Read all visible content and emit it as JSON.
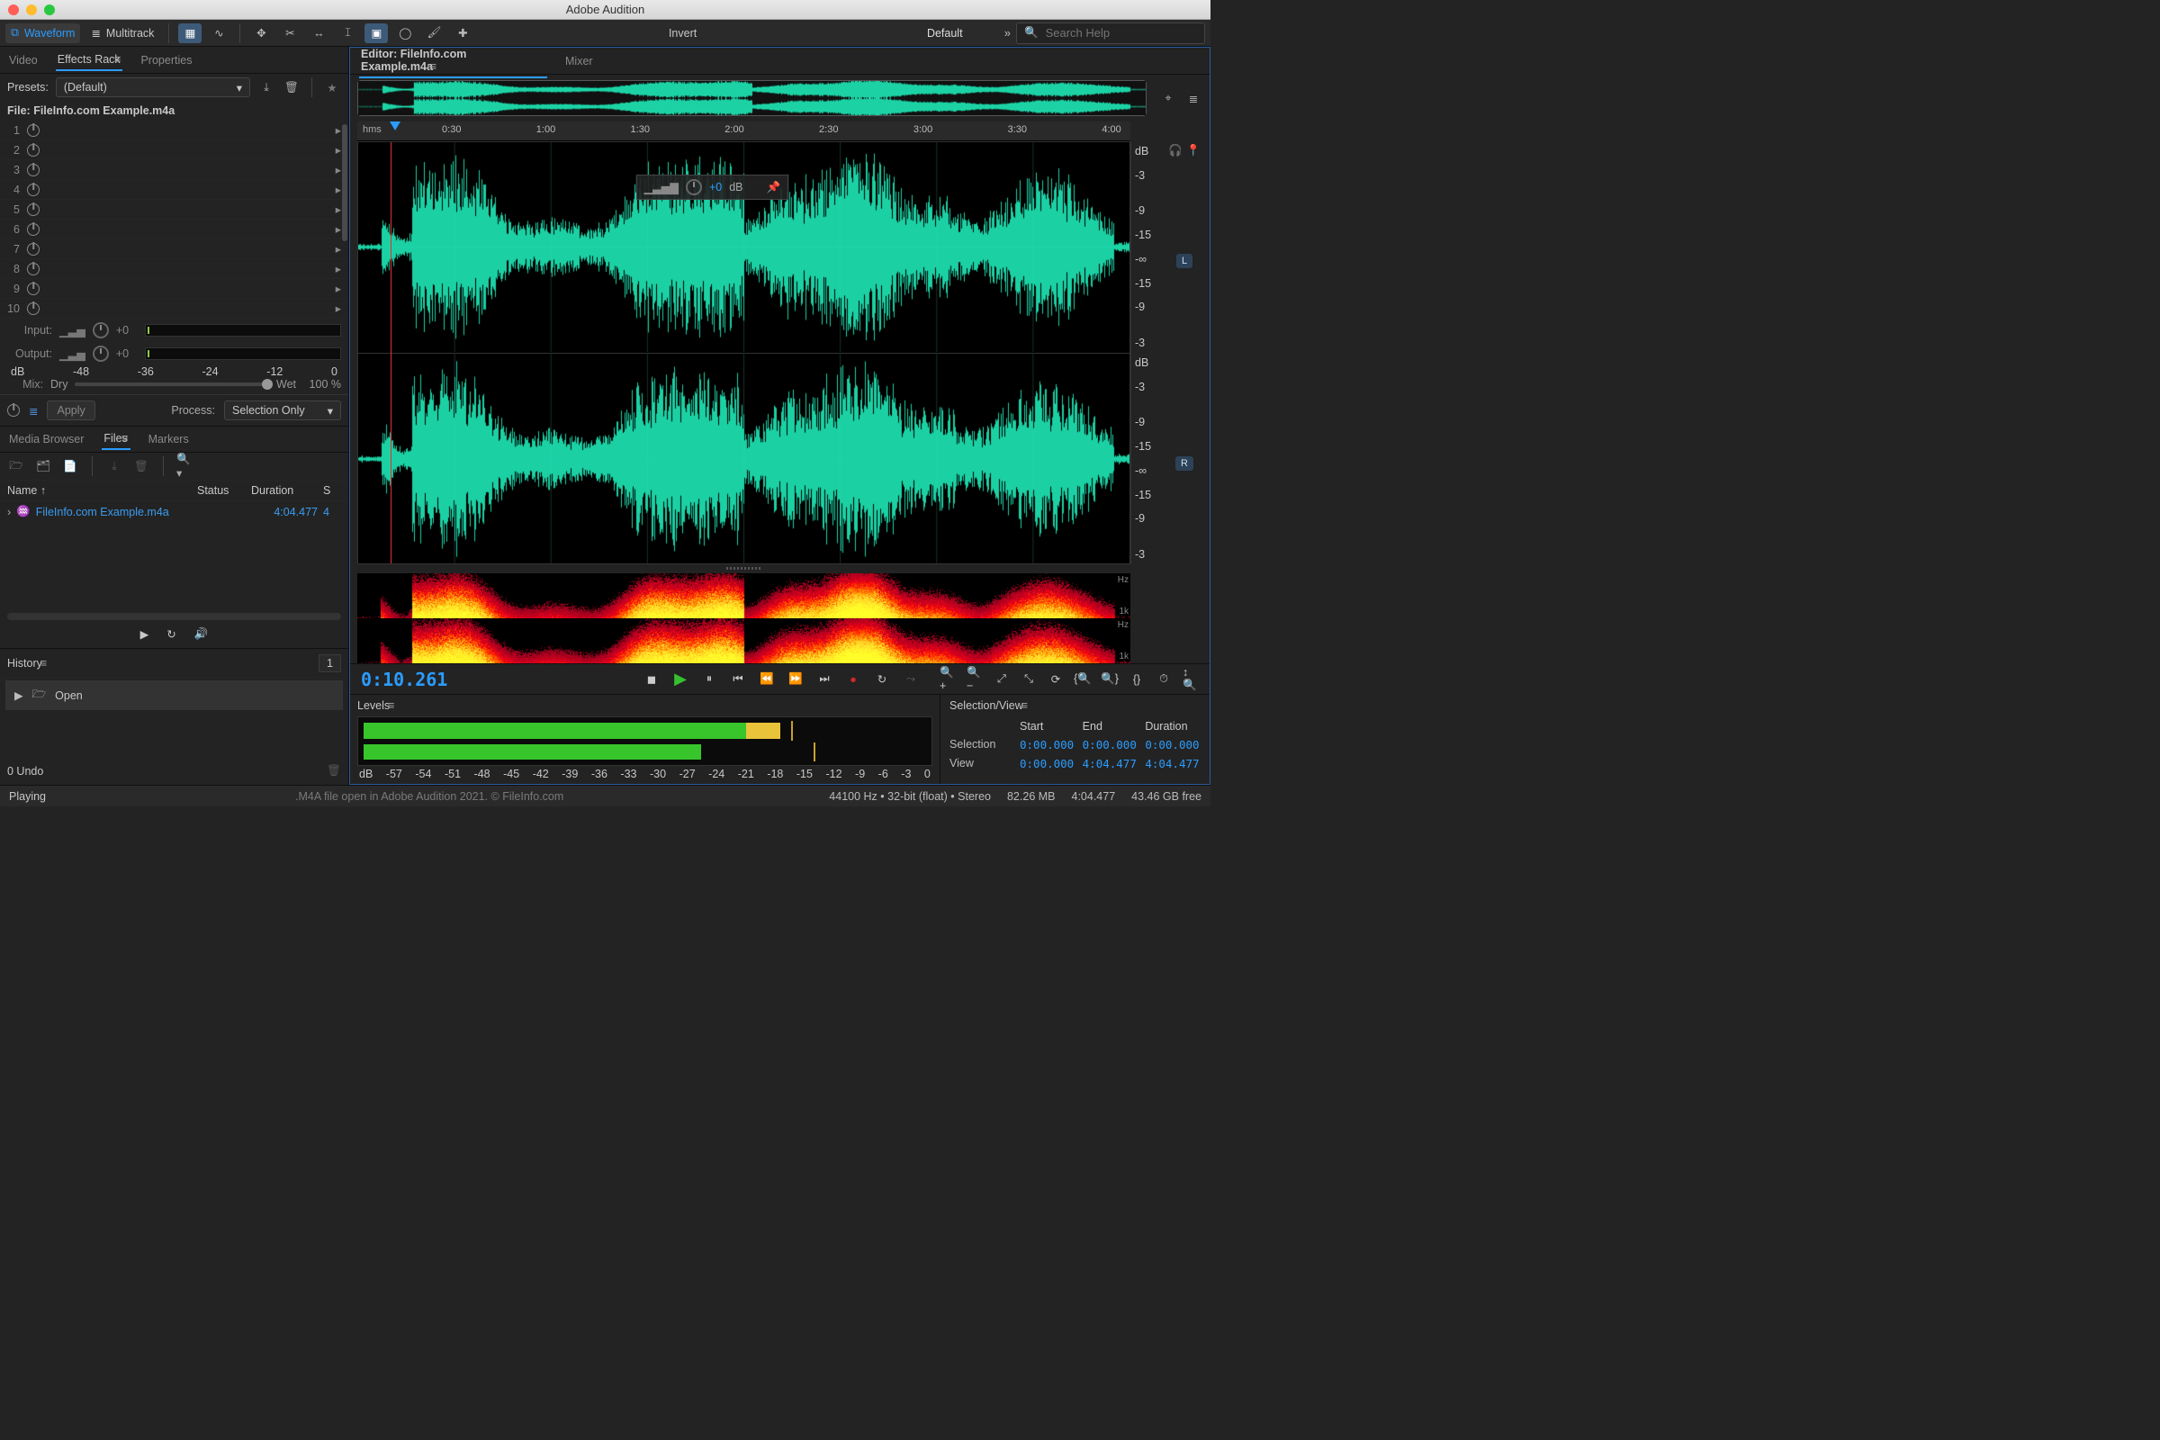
{
  "window": {
    "title": "Adobe Audition"
  },
  "toolbar": {
    "waveform": "Waveform",
    "multitrack": "Multitrack",
    "invert": "Invert",
    "workspace": "Default",
    "search_placeholder": "Search Help"
  },
  "left": {
    "tabs": [
      "Video",
      "Effects Rack",
      "Properties"
    ],
    "active_tab": "Effects Rack",
    "presets_label": "Presets:",
    "preset_value": "(Default)",
    "file_label": "File:",
    "file_name": "FileInfo.com Example.m4a",
    "slots": [
      1,
      2,
      3,
      4,
      5,
      6,
      7,
      8,
      9,
      10
    ],
    "input_label": "Input:",
    "output_label": "Output:",
    "gain": "+0",
    "db_ticks": [
      "dB",
      "-48",
      "-36",
      "-24",
      "-12",
      "0"
    ],
    "mix_label": "Mix:",
    "dry": "Dry",
    "wet": "Wet",
    "wet_pct": "100 %",
    "apply": "Apply",
    "process_label": "Process:",
    "process_value": "Selection Only"
  },
  "files": {
    "tabs": [
      "Media Browser",
      "Files",
      "Markers"
    ],
    "active_tab": "Files",
    "cols": [
      "Name ↑",
      "Status",
      "Duration",
      "S"
    ],
    "row": {
      "name": "FileInfo.com Example.m4a",
      "duration": "4:04.477",
      "s": "4"
    }
  },
  "history": {
    "title": "History",
    "count": "1",
    "item": "Open",
    "undo": "0 Undo"
  },
  "editor": {
    "tab": "Editor: FileInfo.com Example.m4a",
    "mixer": "Mixer",
    "ruler_unit": "hms",
    "ruler": [
      "0:30",
      "1:00",
      "1:30",
      "2:00",
      "2:30",
      "3:00",
      "3:30",
      "4:00"
    ],
    "hud_db": "+0",
    "hud_unit": "dB",
    "db_scale": [
      "dB",
      "-3",
      "",
      "-9",
      "-15",
      "-∞",
      "-15",
      "-9",
      "",
      "-3"
    ],
    "db_top": "dB",
    "hz": "Hz",
    "k1": "1k",
    "L": "L",
    "R": "R",
    "timecode": "0:10.261"
  },
  "levels": {
    "title": "Levels",
    "ticks": [
      "dB",
      "-57",
      "-54",
      "-51",
      "-48",
      "-45",
      "-42",
      "-39",
      "-36",
      "-33",
      "-30",
      "-27",
      "-24",
      "-21",
      "-18",
      "-15",
      "-12",
      "-9",
      "-6",
      "-3",
      "0"
    ]
  },
  "selview": {
    "title": "Selection/View",
    "cols": [
      "Start",
      "End",
      "Duration"
    ],
    "rows": [
      {
        "label": "Selection",
        "start": "0:00.000",
        "end": "0:00.000",
        "dur": "0:00.000"
      },
      {
        "label": "View",
        "start": "0:00.000",
        "end": "4:04.477",
        "dur": "4:04.477"
      }
    ]
  },
  "status": {
    "state": "Playing",
    "caption": ".M4A file open in Adobe Audition 2021. © FileInfo.com",
    "format": "44100 Hz • 32-bit (float) • Stereo",
    "ram": "82.26 MB",
    "dur": "4:04.477",
    "disk": "43.46 GB free"
  }
}
